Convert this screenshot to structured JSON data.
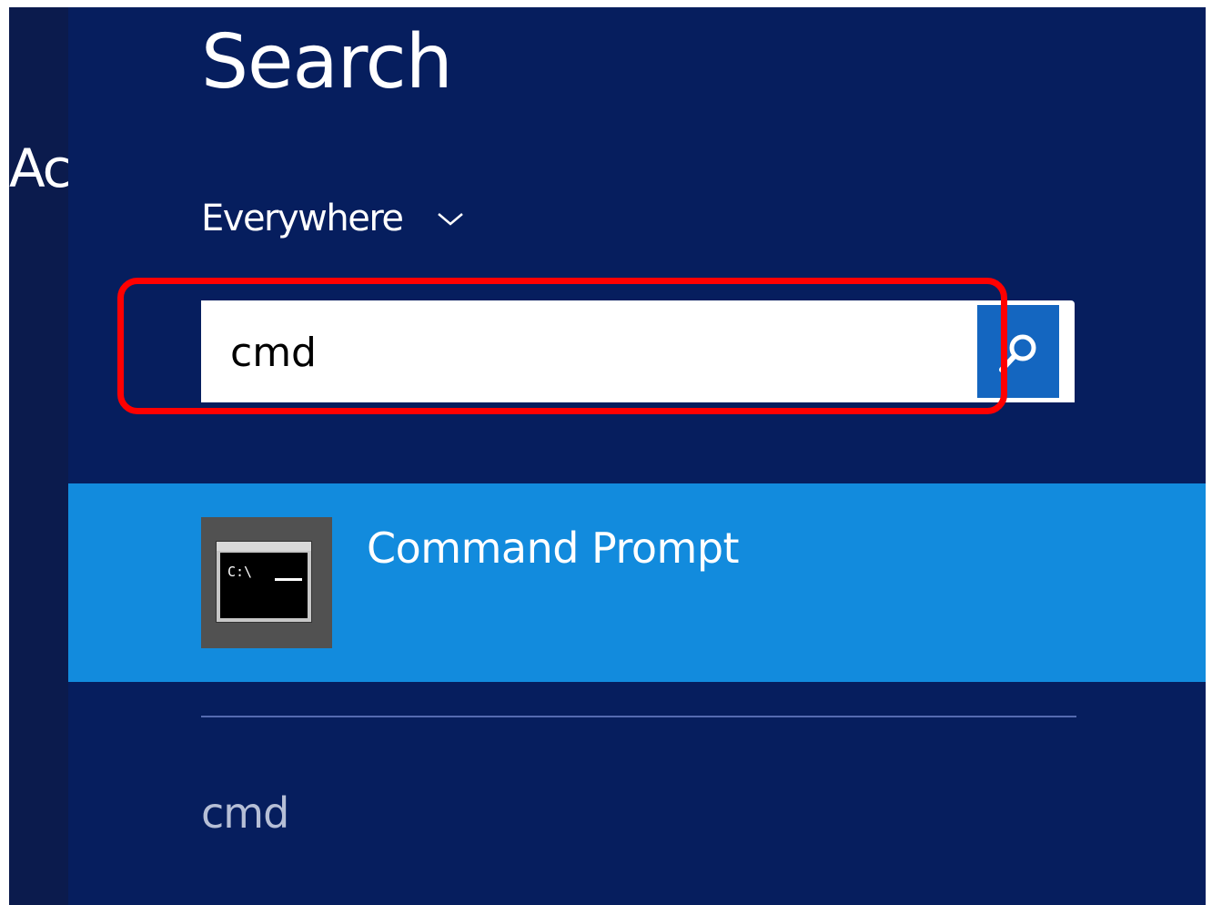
{
  "left_panel": {
    "partial_text": "Ac"
  },
  "search_pane": {
    "title": "Search",
    "scope": {
      "label": "Everywhere"
    },
    "search_box": {
      "value": "cmd",
      "button_icon": "search-icon"
    },
    "results": [
      {
        "label": "Command Prompt",
        "icon": "command-prompt-icon",
        "console_text": "C:\\"
      }
    ],
    "suggestions": [
      "cmd"
    ]
  },
  "colors": {
    "pane_bg": "#061e5e",
    "result_highlight": "#128bdd",
    "search_button": "#1466c0",
    "annotation_border": "#ff0000"
  }
}
